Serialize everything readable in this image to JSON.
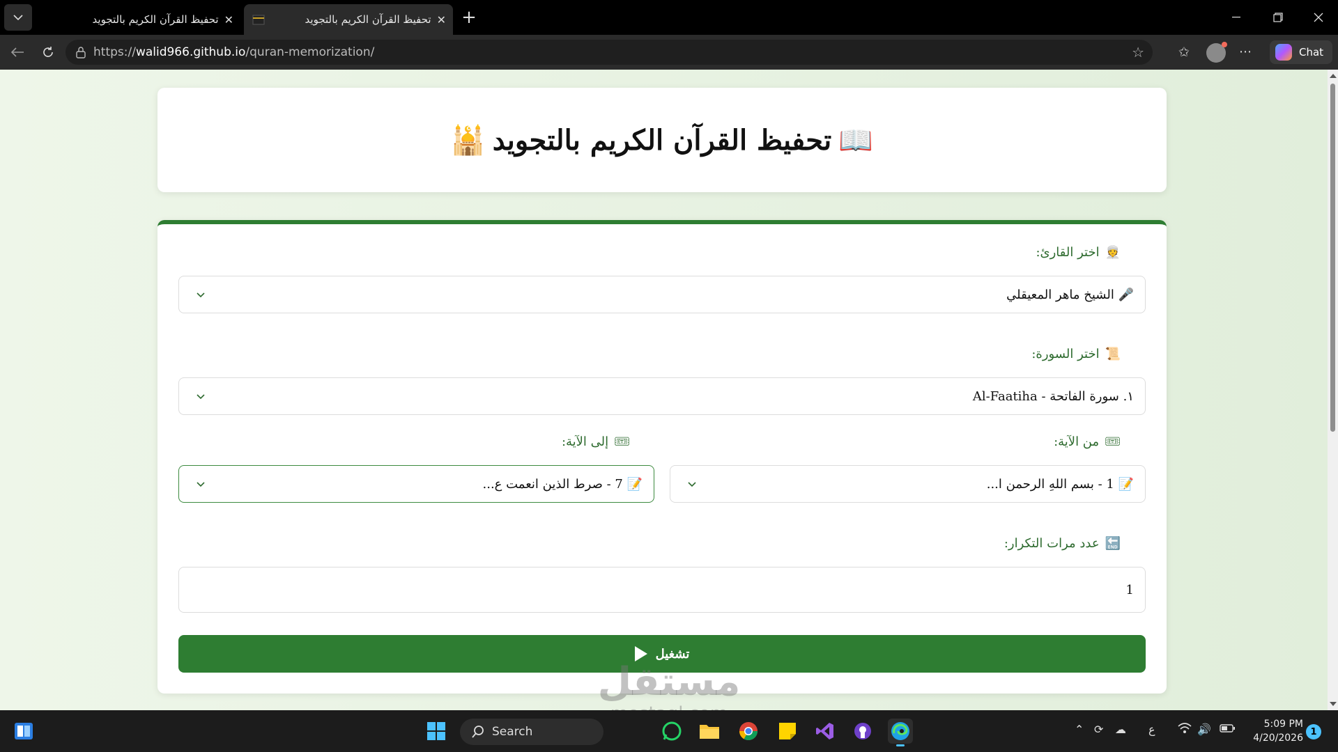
{
  "browser": {
    "tabs": [
      {
        "title": "تحفيظ القرآن الكريم بالتجويد",
        "active": false
      },
      {
        "title": "تحفيظ القرآن الكريم بالتجويد",
        "active": true
      }
    ],
    "url_scheme": "https://",
    "url_host": "walid966.github.io",
    "url_path": "/quran-memorization/",
    "chat_label": "Chat"
  },
  "page": {
    "title_icon": "📖",
    "title": "تحفيظ القرآن الكريم بالتجويد",
    "title_icon_end": "🕌",
    "reciter": {
      "icon": "👳",
      "label": "اختر القارئ:",
      "value_icon": "🎤",
      "value": "الشيخ ماهر المعيقلي"
    },
    "surah": {
      "icon": "📜",
      "label": "اختر السورة:",
      "value": "١. سورة الفاتحة - Al-Faatiha"
    },
    "from_ayah": {
      "icon": "🎟",
      "label": "من الآية:",
      "value_icon": "📝",
      "value": "1 - بسم اللهِ الرحمن ا..."
    },
    "to_ayah": {
      "icon": "🎟",
      "label": "إلى الآية:",
      "value_icon": "📝",
      "value": "7 - صرط الذين انعمت ع..."
    },
    "repeat": {
      "icon": "🔚",
      "label": "عدد مرات التكرار:",
      "value": "1"
    },
    "play_label": "تشغيل",
    "accent_color": "#2e7d32"
  },
  "watermark": {
    "arabic": "مستقل",
    "latin": "mostaql.com"
  },
  "taskbar": {
    "search_label": "Search",
    "language": "ع",
    "time": "5:09 PM",
    "date": "4/20/2026",
    "notifications": "1"
  }
}
